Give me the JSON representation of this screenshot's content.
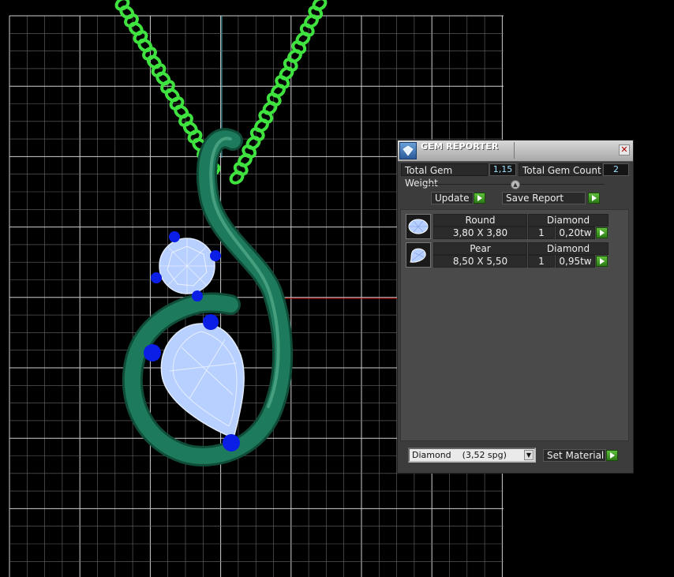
{
  "panel": {
    "title": "GEM REPORTER",
    "total_weight_label": "Total Gem Weight",
    "total_weight_value": "1,15",
    "total_count_label": "Total Gem Count",
    "total_count_value": "2",
    "update_label": "Update",
    "save_report_label": "Save Report",
    "gems": [
      {
        "shape": "Round",
        "material": "Diamond",
        "size": "3,80 X 3,80",
        "qty": "1",
        "weight": "0,20tw"
      },
      {
        "shape": "Pear",
        "material": "Diamond",
        "size": "8,50 X 5,50",
        "qty": "1",
        "weight": "0,95tw"
      }
    ],
    "material_select": "Diamond    (3,52 spg)",
    "set_material_label": "Set Material"
  },
  "colors": {
    "viewport_bg": "#000000",
    "grid": "#bdbdbd",
    "chain": "#3fe23f",
    "metal": "#1e7a5c",
    "gem": "#b8d0ff",
    "prong": "#0a1ee6"
  },
  "icons": {
    "title": "gem-reporter-icon",
    "close": "close-icon",
    "run": "play-arrow-icon",
    "dropdown": "chevron-down-icon",
    "round_gem": "round-gem-icon",
    "pear_gem": "pear-gem-icon"
  }
}
